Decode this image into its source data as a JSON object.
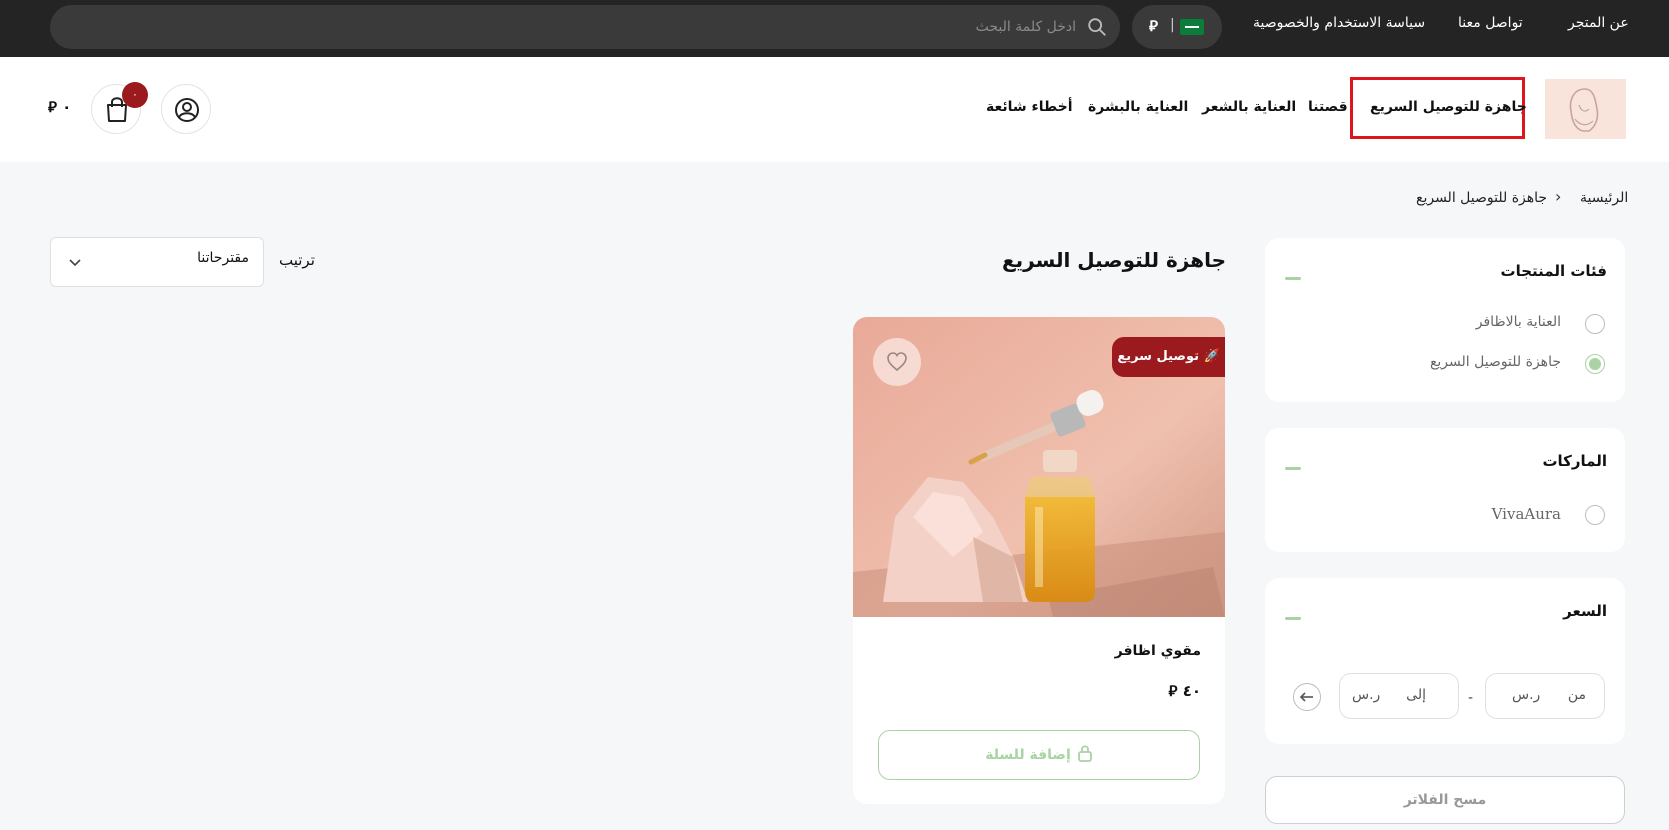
{
  "topbar": {
    "links": [
      "عن المتجر",
      "تواصل معنا",
      "سياسة الاستخدام والخصوصية"
    ],
    "currency_symbol": "⃁",
    "search_placeholder": "ادخل كلمة البحث"
  },
  "header": {
    "nav": [
      "جاهزة للتوصيل السريع",
      "قصتنا",
      "العناية بالشعر",
      "العناية بالبشرة",
      "أخطاء شائعة"
    ],
    "active_nav": "جاهزة للتوصيل السريع",
    "cart_count": "٠",
    "cart_total": "٠ ⃁"
  },
  "breadcrumb": {
    "home": "الرئيسية",
    "current": "جاهزة للتوصيل السريع"
  },
  "filters": {
    "categories": {
      "title": "فئات المنتجات",
      "options": [
        {
          "label": "العناية بالاظافر",
          "selected": false
        },
        {
          "label": "جاهزة للتوصيل السريع",
          "selected": true
        }
      ]
    },
    "brands": {
      "title": "الماركات",
      "options": [
        {
          "label": "VivaAura",
          "selected": false
        }
      ]
    },
    "price": {
      "title": "السعر",
      "from_placeholder": "من",
      "to_placeholder": "إلى",
      "currency": "ر.س",
      "separator": "-"
    },
    "clear_label": "مسح الفلاتر"
  },
  "main": {
    "title": "جاهزة للتوصيل السريع",
    "sort_label": "ترتيب",
    "sort_value": "مقترحاتنا"
  },
  "products": [
    {
      "badge": "🚀 توصيل سريع",
      "name": "مقوي اظافر",
      "price": "٤٠ ⃁",
      "add_label": "إضافة للسلة"
    }
  ],
  "colors": {
    "accent_red": "#9b1a1e",
    "accent_green": "#a9d3a3",
    "topbar_bg": "#242424",
    "highlight_box": "#e0141c"
  }
}
